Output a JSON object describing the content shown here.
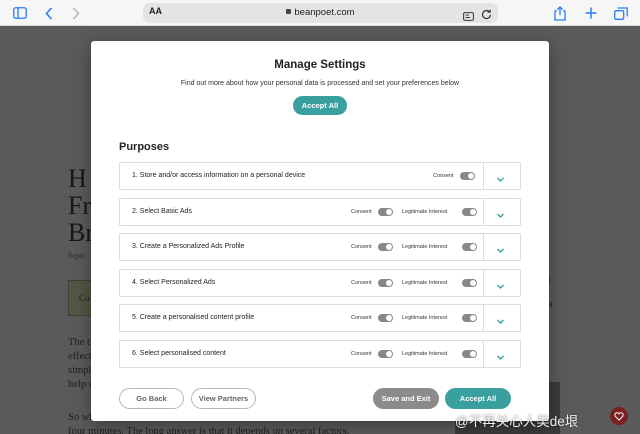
{
  "browser": {
    "reader_label": "AA",
    "url": "beanpoet.com"
  },
  "background_page": {
    "headline_letters": [
      "H",
      "Fr",
      "Br"
    ],
    "date_fragment": "Septe",
    "box_fragment": "Co",
    "body_lines": [
      "The t",
      "effect",
      "simpl",
      "help c",
      "So wh",
      "four minutes. The long answer is that it depends on several factors."
    ],
    "right_fragments": [
      "t",
      "a"
    ]
  },
  "modal": {
    "title": "Manage Settings",
    "description": "Find out more about how your personal data is processed and set your preferences below",
    "accept_all_top": "Accept All",
    "purposes_heading": "Purposes",
    "consent_label": "Consent",
    "legitimate_label": "Legitimate Interest",
    "purposes": [
      {
        "label": "1. Store and/or access information on a personal device",
        "legitimate_interest": false
      },
      {
        "label": "2. Select Basic Ads",
        "legitimate_interest": true
      },
      {
        "label": "3. Create a Personalized Ads Profile",
        "legitimate_interest": true
      },
      {
        "label": "4. Select Personalized Ads",
        "legitimate_interest": true
      },
      {
        "label": "5. Create a personalised content profile",
        "legitimate_interest": true
      },
      {
        "label": "6. Select personalised content",
        "legitimate_interest": true
      }
    ],
    "footer": {
      "go_back": "Go Back",
      "view_partners": "View Partners",
      "save_exit": "Save and Exit",
      "accept_all": "Accept All"
    }
  },
  "watermark": "@不再关心人类de垠",
  "colors": {
    "accent": "#3a9f9f",
    "toggle_off": "#888888",
    "browser_blue": "#2a7cf6"
  }
}
